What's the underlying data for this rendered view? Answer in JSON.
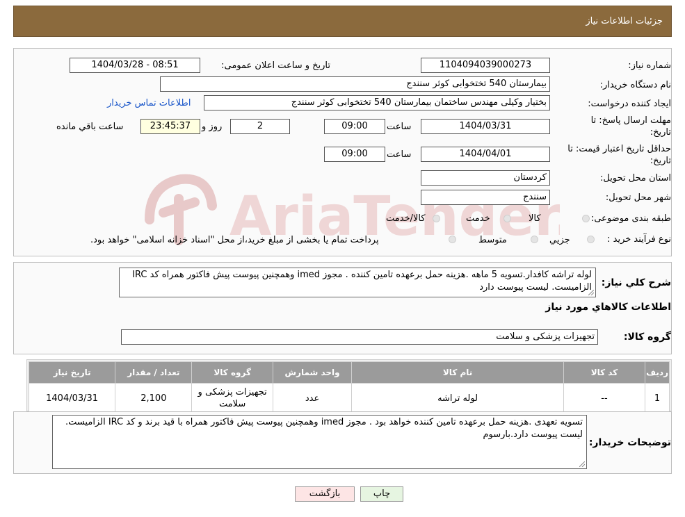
{
  "header": {
    "title": "جزئیات اطلاعات نیاز"
  },
  "fields": {
    "need_number": {
      "label": "شماره نیاز:",
      "value": "1104094039000273"
    },
    "announce_date": {
      "label": "تاریخ و ساعت اعلان عمومی:",
      "value": "1404/03/28 - 08:51"
    },
    "buyer_org": {
      "label": "نام دستگاه خریدار:",
      "value": "بیمارستان 540 تختخوابی کوثر سنندج"
    },
    "requester": {
      "label": "ایجاد کننده درخواست:",
      "value": "بختیار وکیلی مهندس ساختمان بیمارستان 540 تختخوابی کوثر سنندج",
      "contact_link": "اطلاعات تماس خریدار"
    },
    "reply_deadline": {
      "label_line1": "مهلت ارسال پاسخ: تا",
      "label_line2": "تاریخ:",
      "date": "1404/03/31",
      "time_label": "ساعت",
      "time": "09:00",
      "days": "2",
      "days_label": "روز و",
      "remaining": "23:45:37",
      "remaining_label": "ساعت باقي مانده"
    },
    "price_validity": {
      "label_line1": "حداقل تاریخ اعتبار قیمت: تا",
      "label_line2": "تاریخ:",
      "date": "1404/04/01",
      "time_label": "ساعت",
      "time": "09:00"
    },
    "province": {
      "label": "استان محل تحویل:",
      "value": "کردستان"
    },
    "city": {
      "label": "شهر محل تحویل:",
      "value": "سنندج"
    },
    "category": {
      "label": "طبقه بندی موضوعی:",
      "options": [
        "کالا",
        "خدمت",
        "کالا/خدمت"
      ]
    },
    "purchase_type": {
      "label": "نوع فرآیند خرید :",
      "options": [
        "جزیي",
        "متوسط"
      ],
      "note": "پرداخت تمام یا بخشی از مبلغ خرید،از محل \"اسناد خزانه اسلامی\" خواهد بود."
    }
  },
  "watermark": {
    "text": "AriaTender.neT",
    "color": "#e8c9c9"
  },
  "description": {
    "label": "شرح کلي نياز:",
    "text": "لوله تراشه کافدار.تسویه 5 ماهه .هزینه حمل برعهده تامین کننده . مجوز imed وهمچنین پیوست پیش فاکتور همراه کد IRC  الزامیست. لیست پیوست دارد"
  },
  "goods_section": {
    "title": "اطلاعات كالاهاي مورد نياز"
  },
  "goods_group": {
    "label": "گروه کالا:",
    "value": "تجهیزات پزشکی و سلامت"
  },
  "table": {
    "headers": [
      "رديف",
      "کد کالا",
      "نام کالا",
      "واحد شمارش",
      "گروه کالا",
      "تعداد / مقدار",
      "تاریخ نیاز"
    ],
    "rows": [
      [
        "1",
        "--",
        "لوله تراشه",
        "عدد",
        "تجهیزات پزشکی و سلامت",
        "2,100",
        "1404/03/31"
      ]
    ]
  },
  "buyer_notes": {
    "label": "توضیحات خریدار:",
    "text": "تسویه تعهدی .هزینه حمل برعهده تامین کننده خواهد بود . مجوز imed وهمچنین پیوست پیش فاکتور همراه  با قید برند و کد IRC  الزامیست. لیست پیوست دارد.بارسوم"
  },
  "buttons": {
    "print": "چاپ",
    "back": "بازگشت"
  },
  "colors": {
    "header_bg": "#8b6a3d",
    "link": "#1a56c9",
    "table_header": "#9b9b9b"
  }
}
